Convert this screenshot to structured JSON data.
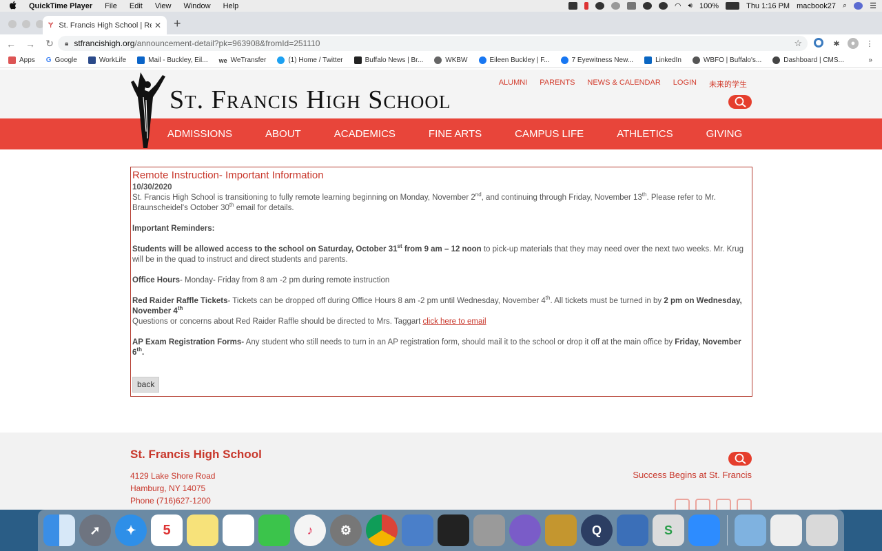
{
  "menubar": {
    "apple": "",
    "app_name": "QuickTime Player",
    "menus": [
      "File",
      "Edit",
      "View",
      "Window",
      "Help"
    ],
    "battery": "100%",
    "clock": "Thu 1:16 PM",
    "user": "macbook27"
  },
  "browser": {
    "tab_title": "St. Francis High School | Remo",
    "url_host": "stfrancishigh.org",
    "url_path": "/announcement-detail?pk=963908&fromId=251110",
    "bookmarks": [
      "Apps",
      "Google",
      "WorkLife",
      "Mail - Buckley, Eil...",
      "WeTransfer",
      "(1) Home / Twitter",
      "Buffalo News | Br...",
      "WKBW",
      "Eileen Buckley | F...",
      "7 Eyewitness New...",
      "LinkedIn",
      "WBFO | Buffalo's...",
      "Dashboard | CMS..."
    ],
    "more": "»"
  },
  "site": {
    "title": "St. Francis High School",
    "util_links": [
      "ALUMNI",
      "PARENTS",
      "NEWS & CALENDAR",
      "LOGIN",
      "未来的学生"
    ],
    "nav": [
      "ADMISSIONS",
      "ABOUT",
      "ACADEMICS",
      "FINE ARTS",
      "CAMPUS LIFE",
      "ATHLETICS",
      "GIVING"
    ]
  },
  "announcement": {
    "title": "Remote Instruction- Important Information",
    "date": "10/30/2020",
    "p1_a": "St. Francis High School is transitioning to fully remote learning beginning on Monday, November 2",
    "p1_sup1": "nd",
    "p1_b": ", and continuing through Friday, November 13",
    "p1_sup2": "th",
    "p1_c": ". Please refer to Mr. Braunscheidel's October 30",
    "p1_sup3": "th",
    "p1_d": " email for details.",
    "reminders_heading": "Important Reminders:",
    "p2_bold_a": "Students will be allowed access to the school on Saturday, October 31",
    "p2_sup": "st",
    "p2_bold_b": " from 9 am – 12 noon",
    "p2_rest": " to pick-up materials that they may need over the next two weeks.  Mr. Krug will be in the quad to instruct and direct students and parents.",
    "p3_bold": "Office Hours",
    "p3_rest": "- Monday- Friday from 8 am -2 pm during remote instruction",
    "p4_bold": "Red Raider Raffle Tickets",
    "p4_a": "-  Tickets can  be dropped off during Office Hours 8 am -2 pm until Wednesday, November 4",
    "p4_sup1": "th",
    "p4_b": ".  All tickets must be turned in by ",
    "p4_bold2": "2 pm on Wednesday, November 4",
    "p4_sup2": "th",
    "p4_c": "Questions or concerns about Red Raider Raffle should be directed to Mrs. Taggart ",
    "p4_link": "click here to email",
    "p5_bold": "AP Exam Registration Forms-",
    "p5_rest": " Any student who still needs to turn in an AP registration form, should mail it to the school or drop it off at the main office by ",
    "p5_bold2": "Friday, November 6",
    "p5_sup": "th",
    "p5_end": ".",
    "back_label": "back"
  },
  "footer": {
    "name": "St. Francis High School",
    "address1": "4129 Lake Shore Road",
    "address2": "Hamburg, NY 14075",
    "phone": "Phone (716)627-1200",
    "tagline": "Success Begins at St. Francis"
  },
  "colors": {
    "brand_red": "#e8453a",
    "text_red": "#c8372b"
  }
}
